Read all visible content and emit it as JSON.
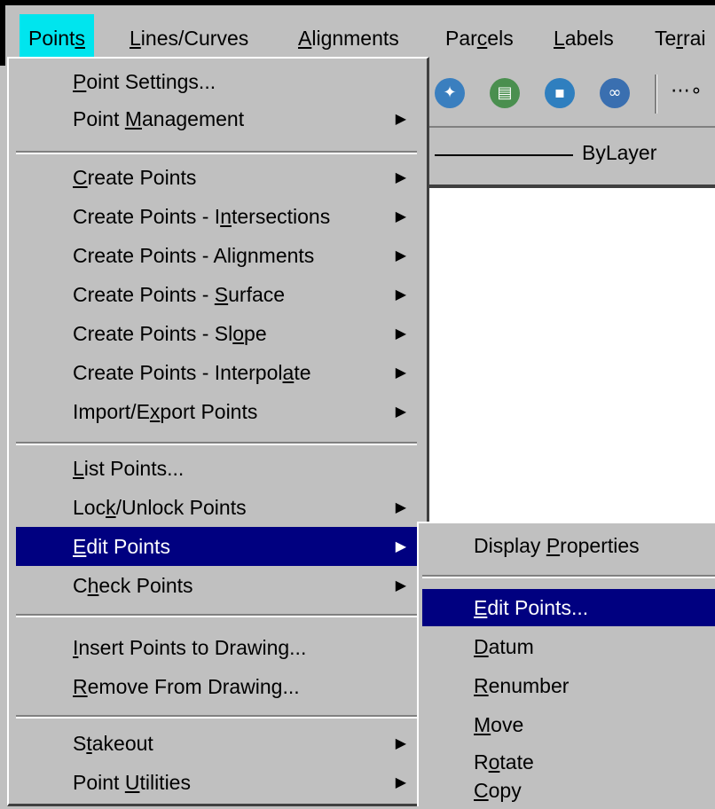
{
  "menubar": {
    "items": [
      {
        "pre": "Point",
        "u": "s",
        "post": ""
      },
      {
        "pre": "",
        "u": "L",
        "post": "ines/Curves"
      },
      {
        "pre": "",
        "u": "A",
        "post": "lignments"
      },
      {
        "pre": "Par",
        "u": "c",
        "post": "els"
      },
      {
        "pre": "",
        "u": "L",
        "post": "abels"
      },
      {
        "pre": "Te",
        "u": "r",
        "post": "rai"
      }
    ]
  },
  "toolbar": {
    "icons": [
      "globe-icon",
      "printer-globe-icon",
      "save-globe-icon",
      "link-globe-icon",
      "line-tool-icon"
    ]
  },
  "layer": {
    "value": "ByLayer"
  },
  "points_menu": {
    "items": [
      {
        "pre": "",
        "u": "P",
        "post": "oint Settings...",
        "submenu": ""
      },
      {
        "pre": "Point ",
        "u": "M",
        "post": "anagement",
        "submenu": "▶"
      },
      {
        "pre": "",
        "u": "C",
        "post": "reate Points",
        "submenu": "▶"
      },
      {
        "pre": "Create Points - I",
        "u": "n",
        "post": "tersections",
        "submenu": "▶"
      },
      {
        "pre": "Create Points - Alignments",
        "u": "",
        "post": "",
        "submenu": "▶"
      },
      {
        "pre": "Create Points - ",
        "u": "S",
        "post": "urface",
        "submenu": "▶"
      },
      {
        "pre": "Create Points - Sl",
        "u": "o",
        "post": "pe",
        "submenu": "▶"
      },
      {
        "pre": "Create Points - Interpol",
        "u": "a",
        "post": "te",
        "submenu": "▶"
      },
      {
        "pre": "Import/E",
        "u": "x",
        "post": "port Points",
        "submenu": "▶"
      },
      {
        "pre": "",
        "u": "L",
        "post": "ist Points...",
        "submenu": ""
      },
      {
        "pre": "Loc",
        "u": "k",
        "post": "/Unlock Points",
        "submenu": "▶"
      },
      {
        "pre": "",
        "u": "E",
        "post": "dit Points",
        "submenu": "▶"
      },
      {
        "pre": "C",
        "u": "h",
        "post": "eck Points",
        "submenu": "▶"
      },
      {
        "pre": "",
        "u": "I",
        "post": "nsert Points to Drawing...",
        "submenu": ""
      },
      {
        "pre": "",
        "u": "R",
        "post": "emove From Drawing...",
        "submenu": ""
      },
      {
        "pre": "S",
        "u": "t",
        "post": "akeout",
        "submenu": "▶"
      },
      {
        "pre": "Point ",
        "u": "U",
        "post": "tilities",
        "submenu": "▶"
      }
    ]
  },
  "edit_submenu": {
    "items": [
      {
        "pre": "Display ",
        "u": "P",
        "post": "roperties"
      },
      {
        "pre": "",
        "u": "E",
        "post": "dit Points..."
      },
      {
        "pre": "",
        "u": "D",
        "post": "atum"
      },
      {
        "pre": "",
        "u": "R",
        "post": "enumber"
      },
      {
        "pre": "",
        "u": "M",
        "post": "ove"
      },
      {
        "pre": "R",
        "u": "o",
        "post": "tate"
      },
      {
        "pre": "",
        "u": "C",
        "post": "opy"
      }
    ]
  },
  "colors": {
    "menu_bg": "#c0c0c0",
    "highlight": "#000080",
    "active_menu": "#00e5ee"
  }
}
